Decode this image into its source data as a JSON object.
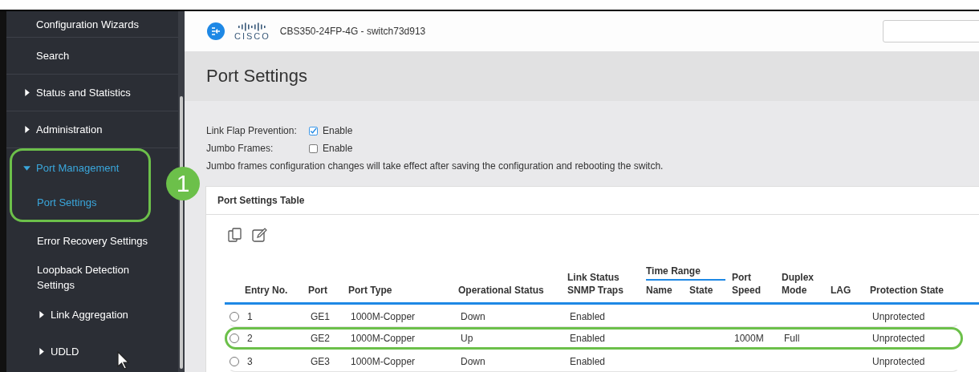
{
  "sidebar": {
    "items": [
      {
        "label": "Configuration Wizards"
      },
      {
        "label": "Search"
      },
      {
        "label": "Status and Statistics",
        "expanded": false
      },
      {
        "label": "Administration",
        "expanded": false
      },
      {
        "label": "Port Management",
        "expanded": true,
        "highlighted": true,
        "children": [
          {
            "label": "Port Settings",
            "selected": true,
            "highlighted": true
          },
          {
            "label": "Error Recovery Settings",
            "selected": false
          },
          {
            "label": "Loopback Detection Settings",
            "selected": false
          },
          {
            "label": "Link Aggregation",
            "selected": false,
            "expanded": false
          },
          {
            "label": "UDLD",
            "selected": false,
            "expanded": false
          }
        ]
      }
    ]
  },
  "step_badge": "1",
  "header": {
    "logo_text": "CISCO",
    "device": "CBS350-24FP-4G - switch73d913"
  },
  "page_title": "Port Settings",
  "settings": [
    {
      "label": "Link Flap Prevention:",
      "option": "Enable",
      "checked": true
    },
    {
      "label": "Jumbo Frames:",
      "option": "Enable",
      "checked": false
    }
  ],
  "note": "Jumbo frames configuration changes will take effect after saving the configuration and rebooting the switch.",
  "table": {
    "title": "Port Settings Table",
    "columns": [
      {
        "label": "Entry No."
      },
      {
        "label": "Port"
      },
      {
        "label": "Port Type"
      },
      {
        "label": "Operational Status"
      },
      {
        "label": "Link Status SNMP Traps"
      },
      {
        "label": "Name",
        "group": "Time Range"
      },
      {
        "label": "State",
        "grouped": true
      },
      {
        "label": "Port Speed"
      },
      {
        "label": "Duplex Mode"
      },
      {
        "label": "LAG"
      },
      {
        "label": "Protection State"
      }
    ],
    "rows": [
      {
        "selected": false,
        "highlighted": false,
        "cells": [
          "1",
          "GE1",
          "1000M-Copper",
          "Down",
          "Enabled",
          "",
          "",
          "",
          "",
          "",
          "Unprotected"
        ]
      },
      {
        "selected": false,
        "highlighted": true,
        "cells": [
          "2",
          "GE2",
          "1000M-Copper",
          "Up",
          "Enabled",
          "",
          "",
          "1000M",
          "Full",
          "",
          "Unprotected"
        ]
      },
      {
        "selected": false,
        "highlighted": false,
        "cells": [
          "3",
          "GE3",
          "1000M-Copper",
          "Down",
          "Enabled",
          "",
          "",
          "",
          "",
          "",
          "Unprotected"
        ]
      }
    ]
  }
}
